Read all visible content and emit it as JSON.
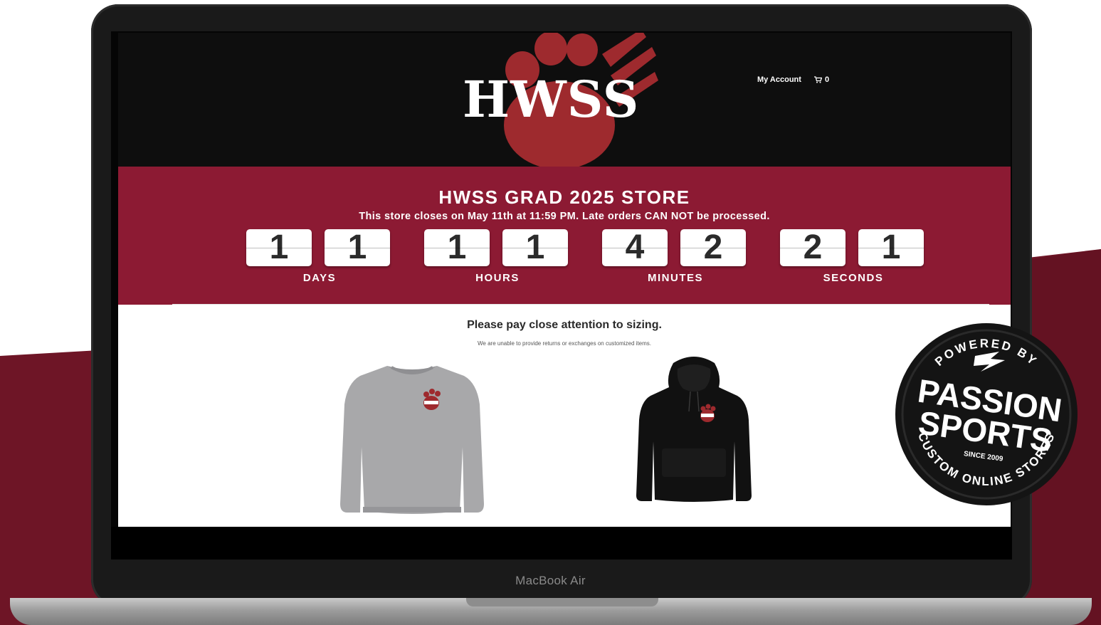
{
  "header": {
    "logo_text": "HWSS",
    "nav": {
      "account_label": "My Account",
      "cart_count": "0"
    }
  },
  "hero": {
    "title": "HWSS GRAD 2025 STORE",
    "subtitle": "This store closes on May 11th at 11:59 PM. Late orders CAN NOT be processed."
  },
  "countdown": {
    "days": [
      "1",
      "1"
    ],
    "hours": [
      "1",
      "1"
    ],
    "minutes": [
      "4",
      "2"
    ],
    "seconds": [
      "2",
      "1"
    ],
    "labels": {
      "days": "DAYS",
      "hours": "HOURS",
      "minutes": "MINUTES",
      "seconds": "SECONDS"
    }
  },
  "notice": {
    "heading": "Please pay close attention to sizing.",
    "detail": "We are unable to provide returns or exchanges on customized items."
  },
  "products": [
    {
      "name": "grey-crewneck-sweatshirt",
      "color": "#a8a8aa"
    },
    {
      "name": "black-hoodie",
      "color": "#111111"
    }
  ],
  "device": {
    "label": "MacBook Air"
  },
  "badge": {
    "top_text": "POWERED BY",
    "brand_line1": "PASSION",
    "brand_line2": "SPORTS",
    "since": "SINCE 2009",
    "bottom_text": "CUSTOM ONLINE STORES"
  },
  "colors": {
    "brand_maroon": "#8c1a33",
    "paw_red": "#9e2a2e",
    "backdrop_maroon": "#6e1526",
    "header_black": "#0e0e0e"
  }
}
